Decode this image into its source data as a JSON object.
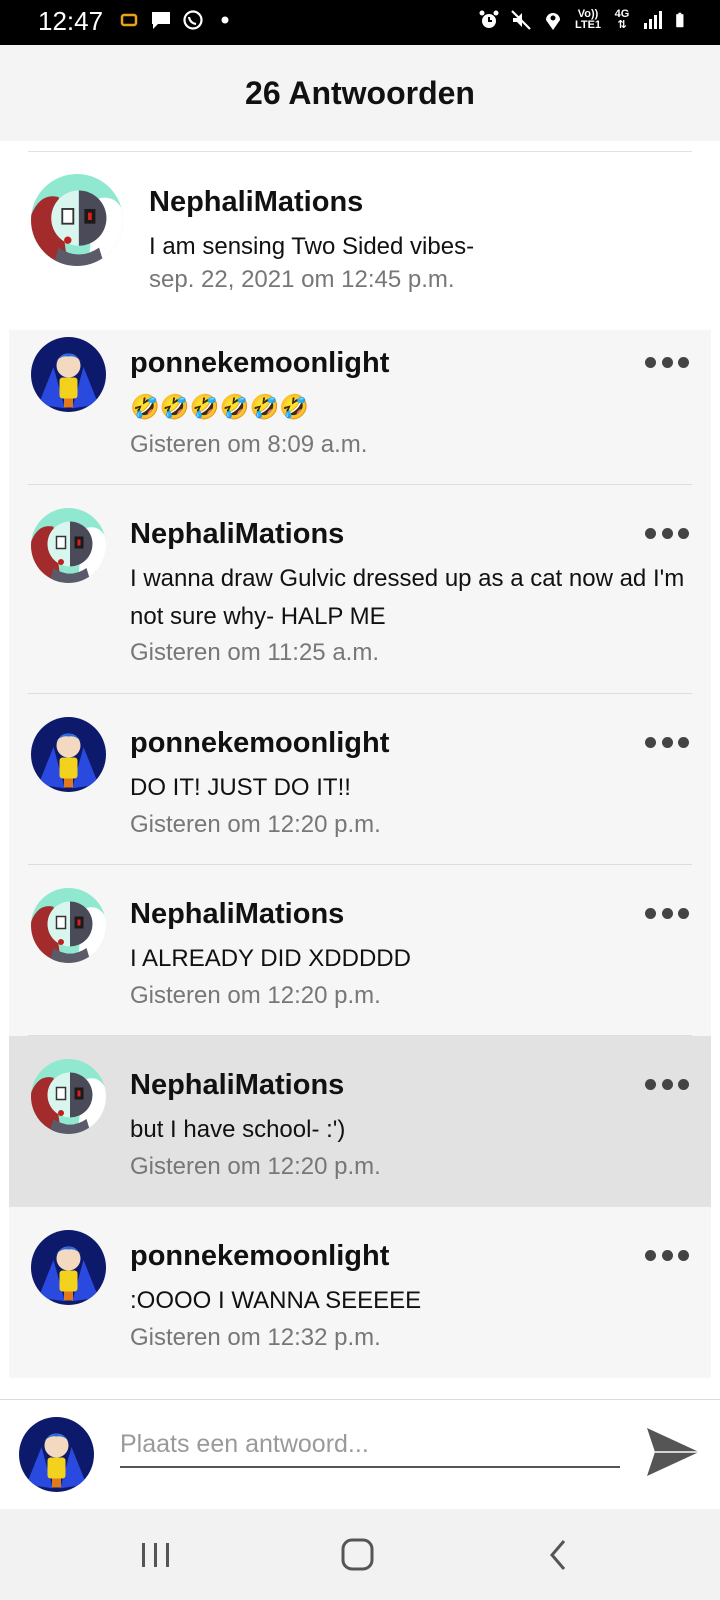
{
  "status_bar": {
    "time": "12:47",
    "network_label_top": "Vo))",
    "network_label_bottom": "LTE1",
    "network_type": "4G",
    "icons_left": [
      "rotation-icon",
      "message-icon",
      "whatsapp-icon",
      "dot-icon"
    ],
    "icons_right": [
      "alarm-icon",
      "mute-icon",
      "location-icon",
      "network-icon",
      "signal-icon",
      "battery-icon"
    ]
  },
  "header": {
    "title": "26 Antwoorden"
  },
  "parent_comment": {
    "username": "NephaliMations",
    "text": "I am sensing Two Sided vibes-",
    "timestamp": "sep. 22, 2021 om 12:45 p.m."
  },
  "replies": [
    {
      "username": "ponnekemoonlight",
      "text": "🤣🤣🤣🤣🤣🤣",
      "timestamp": "Gisteren om 8:09 a.m."
    },
    {
      "username": "NephaliMations",
      "text": "I wanna draw Gulvic dressed up as a cat now ad I'm not sure why- HALP ME",
      "timestamp": "Gisteren om 11:25 a.m."
    },
    {
      "username": "ponnekemoonlight",
      "text": "DO IT! JUST DO IT!!",
      "timestamp": "Gisteren om 12:20 p.m."
    },
    {
      "username": "NephaliMations",
      "text": "I ALREADY DID XDDDDD",
      "timestamp": "Gisteren om 12:20 p.m."
    },
    {
      "username": "NephaliMations",
      "text": "but I have school- :')",
      "timestamp": "Gisteren om 12:20 p.m."
    },
    {
      "username": "ponnekemoonlight",
      "text": ":OOOO I WANNA SEEEEE",
      "timestamp": "Gisteren om 12:32 p.m."
    }
  ],
  "composer": {
    "placeholder": "Plaats een antwoord..."
  },
  "nav_bar": {
    "buttons": [
      "recents-icon",
      "home-icon",
      "back-icon"
    ]
  },
  "colors": {
    "header_bg": "#f4f4f4",
    "reply_bg": "#f6f6f6",
    "highlight_bg": "#e2e2e2",
    "timestamp": "#777777"
  }
}
